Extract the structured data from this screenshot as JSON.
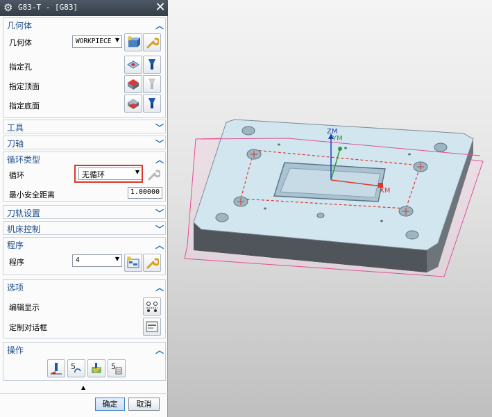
{
  "window": {
    "title": "G83-T - [G83]",
    "gear_icon": "gear-icon",
    "close_glyph": "✕"
  },
  "groups": {
    "geometry": {
      "title": "几何体",
      "label": "几何体",
      "value": "WORKPIECE",
      "rows": [
        "指定孔",
        "指定顶面",
        "指定底面"
      ]
    },
    "tool": {
      "title": "工具"
    },
    "axis": {
      "title": "刀轴"
    },
    "cycle": {
      "title": "循环类型",
      "cycle_label": "循环",
      "cycle_value": "无循环",
      "clearance_label": "最小安全距离",
      "clearance_value": "1.00000"
    },
    "path": {
      "title": "刀轨设置"
    },
    "machine": {
      "title": "机床控制"
    },
    "program": {
      "title": "程序",
      "label": "程序",
      "value": "4"
    },
    "options": {
      "title": "选项",
      "edit_display": "编辑显示",
      "custom_dialog": "定制对话框"
    },
    "actions": {
      "title": "操作"
    }
  },
  "buttons": {
    "ok": "确定",
    "cancel": "取消"
  },
  "expand_glyph": "▲",
  "chevron_up": "⌃",
  "chevron_down": "⌄",
  "csys_labels": {
    "zm": "ZM",
    "ym": "YM",
    "xm": "XM"
  },
  "colors": {
    "title_bar": "#3d4651",
    "group_title": "#1e4f8f",
    "highlight": "#d9382b",
    "part_face": "#d2e6ef",
    "part_side": "#5a6066"
  }
}
